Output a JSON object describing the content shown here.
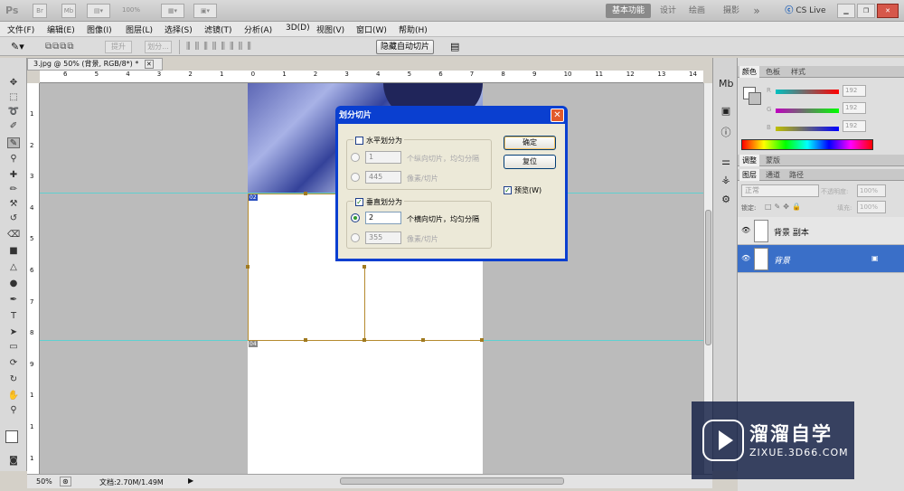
{
  "appbar": {
    "logo": "Ps",
    "zoom": "100%",
    "workspaces": [
      "基本功能",
      "设计",
      "绘画",
      "摄影"
    ],
    "more": "»",
    "cslive": "CS Live"
  },
  "menu": [
    "文件(F)",
    "编辑(E)",
    "图像(I)",
    "图层(L)",
    "选择(S)",
    "滤镜(T)",
    "分析(A)",
    "3D(D)",
    "视图(V)",
    "窗口(W)",
    "帮助(H)"
  ],
  "options": {
    "promote": "提升",
    "divide": "划分...",
    "hide_auto_slices": "隐藏自动切片"
  },
  "document": {
    "tab_title": "3.jpg @ 50% (背景, RGB/8*) *",
    "slice_tags": [
      "02",
      "04"
    ],
    "hruler": [
      "6",
      "5",
      "4",
      "3",
      "2",
      "1",
      "0",
      "1",
      "2",
      "3",
      "4",
      "5",
      "6",
      "7",
      "8",
      "9",
      "10",
      "11",
      "12",
      "13",
      "14"
    ],
    "vruler": [
      "1",
      "2",
      "3",
      "4",
      "5",
      "6",
      "7",
      "8",
      "9",
      "1",
      "1",
      "1"
    ]
  },
  "status": {
    "zoom": "50%",
    "doc_info": "文档:2.70M/1.49M"
  },
  "dialog": {
    "title": "划分切片",
    "horizontal": {
      "label": "水平划分为",
      "count": "1",
      "count_suffix": "个纵向切片，均匀分隔",
      "pixels": "445",
      "pixels_suffix": "像素/切片"
    },
    "vertical": {
      "label": "垂直划分为",
      "count": "2",
      "count_suffix": "个横向切片，均匀分隔",
      "pixels": "355",
      "pixels_suffix": "像素/切片"
    },
    "ok": "确定",
    "reset": "复位",
    "preview": "预览(W)"
  },
  "color_panel": {
    "tabs": [
      "颜色",
      "色板",
      "样式"
    ],
    "channels": [
      {
        "label": "R",
        "value": "192"
      },
      {
        "label": "G",
        "value": "192"
      },
      {
        "label": "B",
        "value": "192"
      }
    ]
  },
  "adjust_panel": {
    "tabs": [
      "调整",
      "蒙版"
    ]
  },
  "layers_panel": {
    "tabs": [
      "图层",
      "通道",
      "路径"
    ],
    "blend_mode": "正常",
    "opacity_label": "不透明度:",
    "opacity": "100%",
    "lock_label": "锁定:",
    "fill_label": "填充:",
    "fill": "100%",
    "layers": [
      {
        "name": "背景 副本",
        "selected": false
      },
      {
        "name": "背景",
        "selected": true
      }
    ]
  },
  "watermark": {
    "cn": "溜溜自学",
    "url": "ZIXUE.3D66.COM"
  },
  "colors": {
    "selection_blue": "#3a6fc8",
    "dialog_title": "#0a3fd0",
    "guide": "#5fd0d0",
    "slice": "#b58a2e"
  }
}
